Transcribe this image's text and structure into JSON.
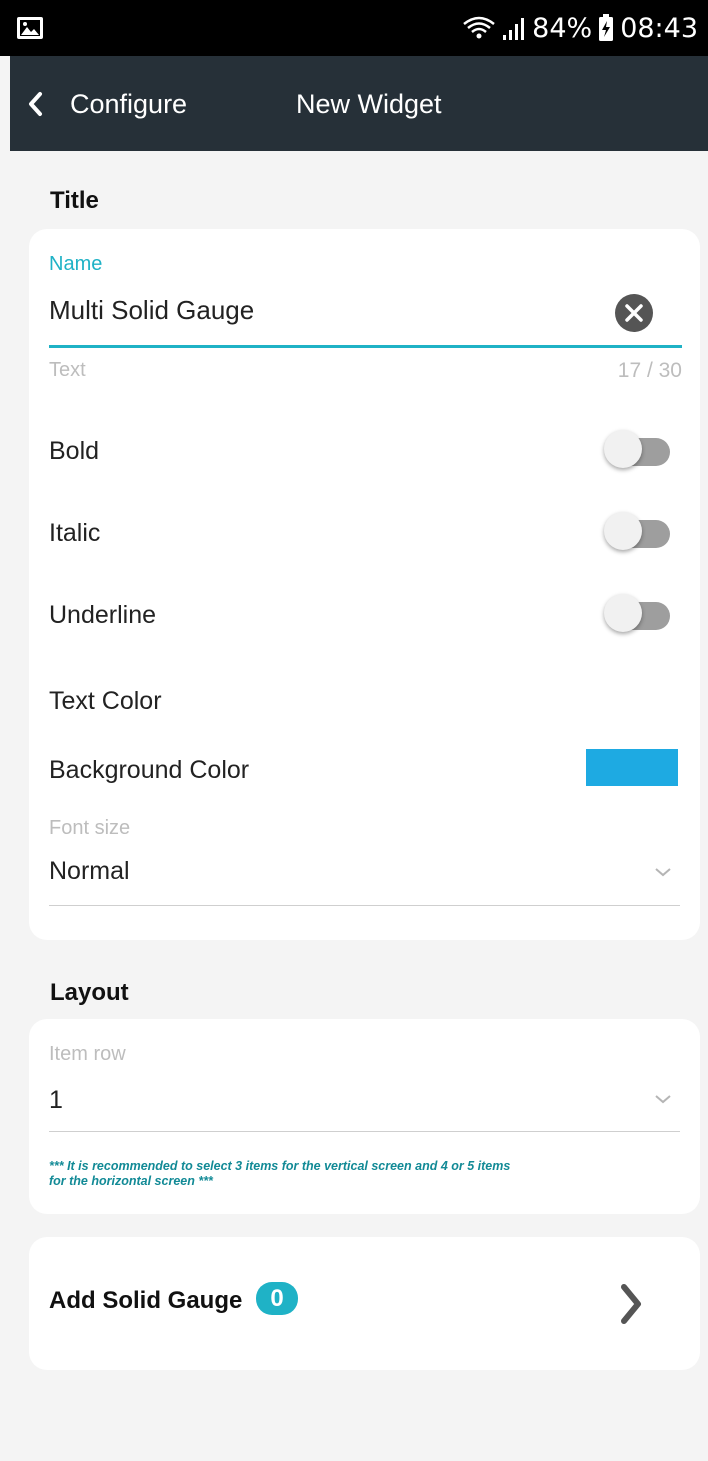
{
  "status_bar": {
    "battery": "84%",
    "time": "08:43",
    "icons": [
      "gallery-icon",
      "wifi-icon",
      "signal-icon",
      "battery-charging-icon"
    ]
  },
  "app_bar": {
    "back_label": "Configure",
    "title": "New Widget"
  },
  "title_section": {
    "heading": "Title",
    "name_field": {
      "label": "Name",
      "value": "Multi Solid Gauge",
      "helper": "Text",
      "counter": "17 / 30",
      "accent_color": "#1fb2c6"
    },
    "bold_label": "Bold",
    "bold_on": false,
    "italic_label": "Italic",
    "italic_on": false,
    "underline_label": "Underline",
    "underline_on": false,
    "text_color_label": "Text Color",
    "background_color_label": "Background Color",
    "background_color_swatch": "#1eaae2",
    "font_size": {
      "label": "Font size",
      "value": "Normal"
    }
  },
  "layout_section": {
    "heading": "Layout",
    "item_row": {
      "label": "Item row",
      "value": "1"
    },
    "note_line1": "*** It is recommended to select 3 items for the vertical screen and 4 or 5 items",
    "note_line2": "for the horizontal screen ***",
    "note_color": "#128a96"
  },
  "add_gauge": {
    "label": "Add Solid Gauge",
    "count": "0",
    "badge_color": "#1fb2c6"
  }
}
